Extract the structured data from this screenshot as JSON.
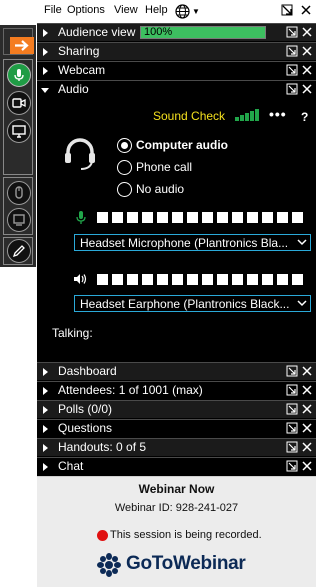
{
  "menu": {
    "file": "File",
    "options": "Options",
    "view": "View",
    "help": "Help"
  },
  "sections": {
    "audience_view": {
      "label": "Audience view",
      "progress_text": "100%",
      "progress": 1.0
    },
    "sharing": {
      "label": "Sharing"
    },
    "webcam": {
      "label": "Webcam"
    },
    "audio": {
      "label": "Audio"
    },
    "dashboard": {
      "label": "Dashboard"
    },
    "attendees": {
      "label": "Attendees:  1 of 1001 (max)"
    },
    "polls": {
      "label": "Polls (0/0)"
    },
    "questions": {
      "label": "Questions"
    },
    "handouts": {
      "label": "Handouts: 0 of 5"
    },
    "chat": {
      "label": "Chat"
    }
  },
  "audio": {
    "sound_check": "Sound Check",
    "more": "•••",
    "help": "?",
    "options": [
      {
        "label": "Computer audio",
        "selected": true
      },
      {
        "label": "Phone call",
        "selected": false
      },
      {
        "label": "No audio",
        "selected": false
      }
    ],
    "microphone": "Headset Microphone (Plantronics Bla...",
    "speaker": "Headset Earphone (Plantronics Black...",
    "talking": "Talking:"
  },
  "footer": {
    "title": "Webinar Now",
    "webinar_id": "Webinar ID: 928-241-027",
    "recording": "This session is being recorded.",
    "brand": "GoToWebinar"
  },
  "colors": {
    "accent_orange": "#f47c20",
    "mic_green": "#21a64a",
    "sound_check_yellow": "#f4e01e",
    "dropdown_border": "#2aa9d8",
    "recording_red": "#e01010",
    "progress_green": "#3dbf60"
  },
  "icons": {
    "grab_tab": [
      "arrow-right-icon",
      "microphone-icon",
      "webcam-icon",
      "screen-icon",
      "mouse-icon",
      "handout-icon",
      "pencil-icon"
    ],
    "section_controls": [
      "popout-icon",
      "close-icon"
    ]
  }
}
